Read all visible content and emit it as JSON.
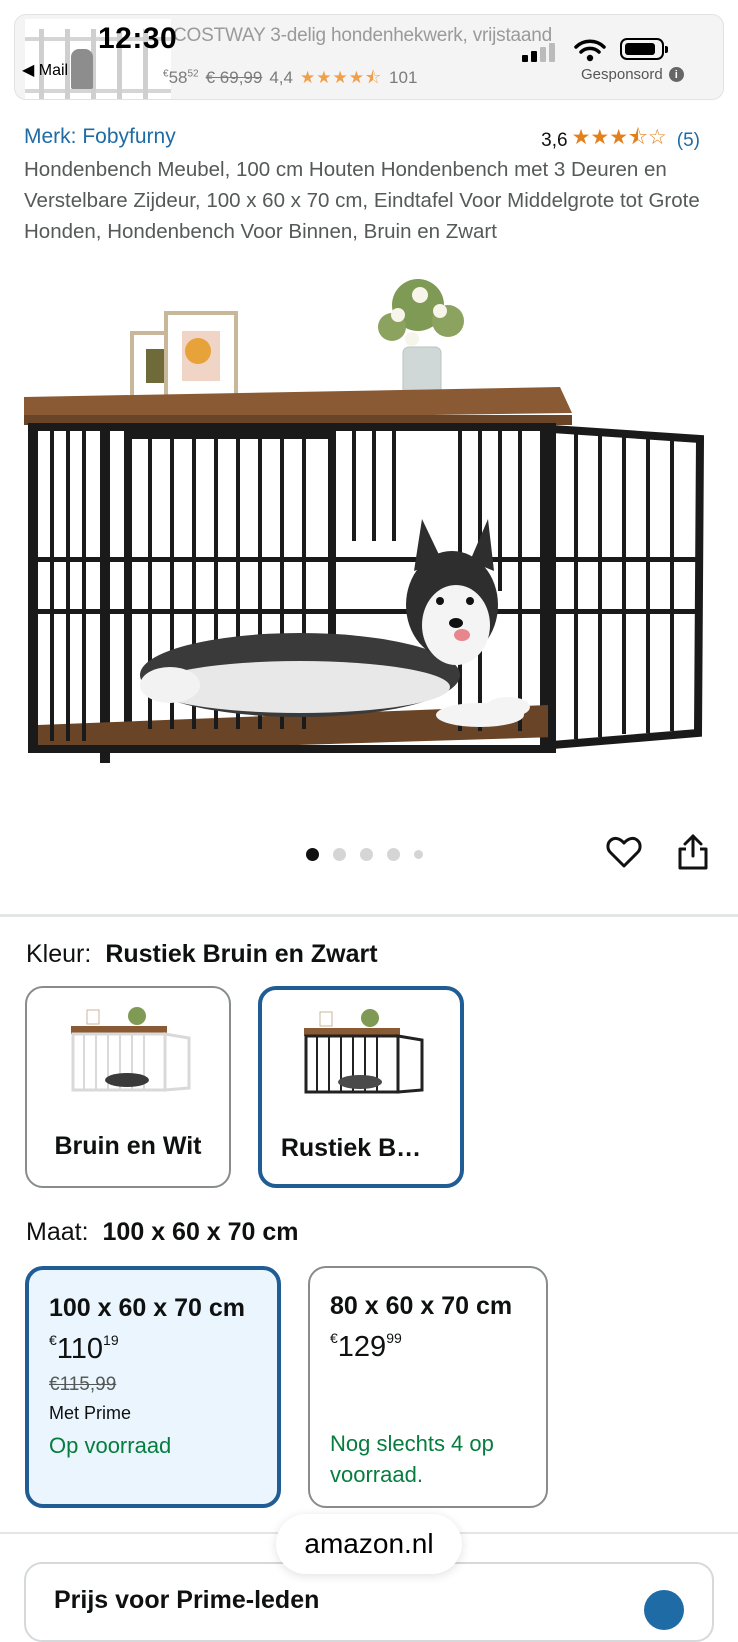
{
  "status_bar": {
    "time": "12:30",
    "back_app": "◀ Mail"
  },
  "ad": {
    "title": "COSTWAY 3-delig hondenhekwerk, vrijstaand",
    "price_currency": "€",
    "price_main": "58",
    "price_fraction": "52",
    "old_price": "€ 69,99",
    "rating": "4,4",
    "stars": "★★★★⯪",
    "review_count": "101",
    "sponsored_label": "Gesponsord"
  },
  "product": {
    "brand": "Merk: Fobyfurny",
    "rating_value": "3,6",
    "rating_stars": "★★★⯪☆",
    "rating_count": "(5)",
    "title": "Hondenbench Meubel, 100 cm Houten Hondenbench met 3 Deuren en Verstelbare Zijdeur, 100 x 60 x 70 cm, Eindtafel Voor Middelgrote tot Grote Honden, Hondenbench Voor Binnen, Bruin en Zwart"
  },
  "carousel": {
    "image_count": 5,
    "active_index": 0
  },
  "color_variation": {
    "label": "Kleur:",
    "selected": "Rustiek Bruin en Zwart",
    "options": [
      {
        "name": "Bruin en Wit",
        "selected": false
      },
      {
        "name": "Rustiek B…",
        "selected": true
      }
    ]
  },
  "size_variation": {
    "label": "Maat:",
    "selected": "100 x 60 x 70 cm",
    "options": [
      {
        "name": "100 x 60 x 70 cm",
        "price_currency": "€",
        "price_main": "110",
        "price_fraction": "19",
        "old_price": "€115,99",
        "prime": "Met Prime",
        "stock": "Op voorraad",
        "selected": true
      },
      {
        "name": "80 x 60 x 70 cm",
        "price_currency": "€",
        "price_main": "129",
        "price_fraction": "99",
        "stock_line1": "Nog slechts 4 op",
        "stock_line2": "voorraad.",
        "selected": false
      }
    ]
  },
  "browser": {
    "url": "amazon.nl"
  },
  "next_section": {
    "title": "Prijs voor Prime-leden"
  },
  "colors": {
    "link": "#1f6ba6",
    "star": "#e4801c",
    "selected_border": "#1f5d94",
    "in_stock": "#067d3e"
  },
  "icons": [
    "mail-back-icon",
    "wifi-icon",
    "battery-icon",
    "info-icon",
    "heart-icon",
    "share-icon"
  ]
}
